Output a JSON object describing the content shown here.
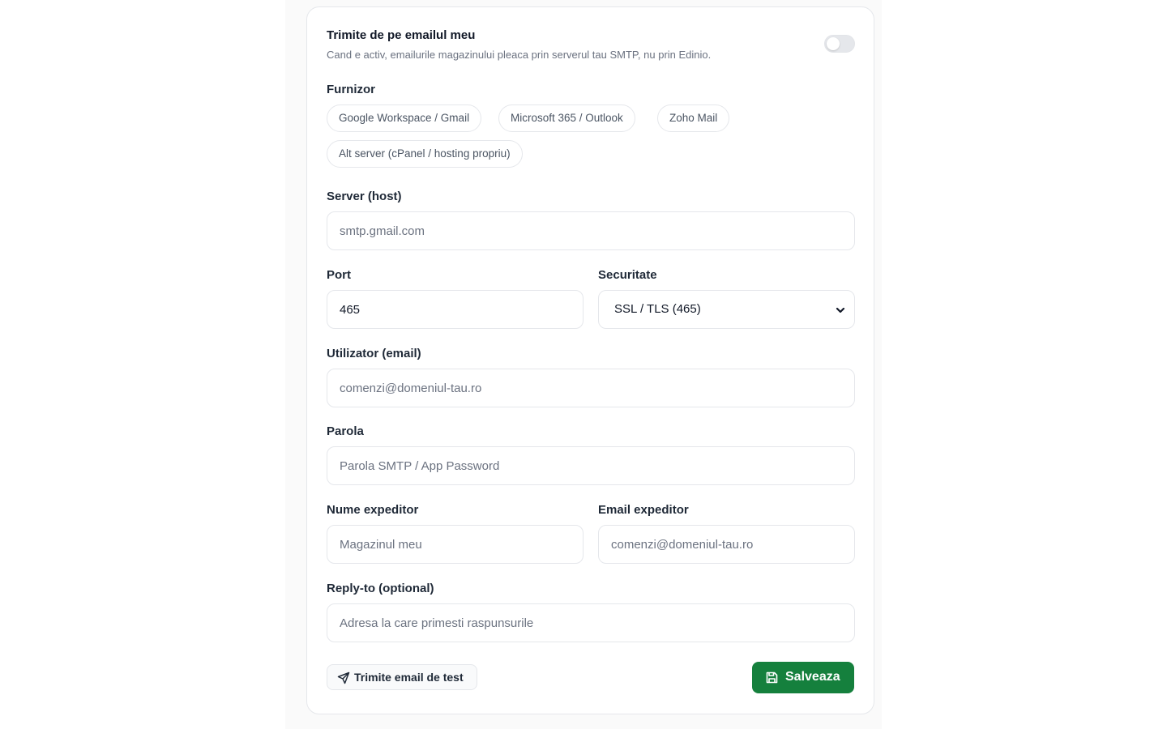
{
  "header": {
    "title": "Trimite de pe emailul meu",
    "description": "Cand e activ, emailurile magazinului pleaca prin serverul tau SMTP, nu prin Edinio.",
    "toggle_on": false
  },
  "provider": {
    "label": "Furnizor",
    "options": [
      "Google Workspace / Gmail",
      "Microsoft 365 / Outlook",
      "Zoho Mail",
      "Alt server (cPanel / hosting propriu)"
    ]
  },
  "host": {
    "label": "Server (host)",
    "placeholder": "smtp.gmail.com",
    "value": ""
  },
  "port": {
    "label": "Port",
    "value": "465"
  },
  "security": {
    "label": "Securitate",
    "selected": "SSL / TLS (465)"
  },
  "user": {
    "label": "Utilizator (email)",
    "placeholder": "comenzi@domeniul-tau.ro",
    "value": ""
  },
  "password": {
    "label": "Parola",
    "placeholder": "Parola SMTP / App Password",
    "value": ""
  },
  "sender_name": {
    "label": "Nume expeditor",
    "placeholder": "Magazinul meu",
    "value": ""
  },
  "sender_email": {
    "label": "Email expeditor",
    "placeholder": "comenzi@domeniul-tau.ro",
    "value": ""
  },
  "reply_to": {
    "label": "Reply-to (optional)",
    "placeholder": "Adresa la care primesti raspunsurile",
    "value": ""
  },
  "actions": {
    "test_label": "Trimite email de test",
    "save_label": "Salveaza"
  },
  "colors": {
    "accent": "#15803d",
    "border": "#e5e7eb",
    "muted_text": "#6b7280"
  },
  "icons": {
    "test": "send-icon",
    "save": "save-icon",
    "select": "chevron-down-icon"
  }
}
